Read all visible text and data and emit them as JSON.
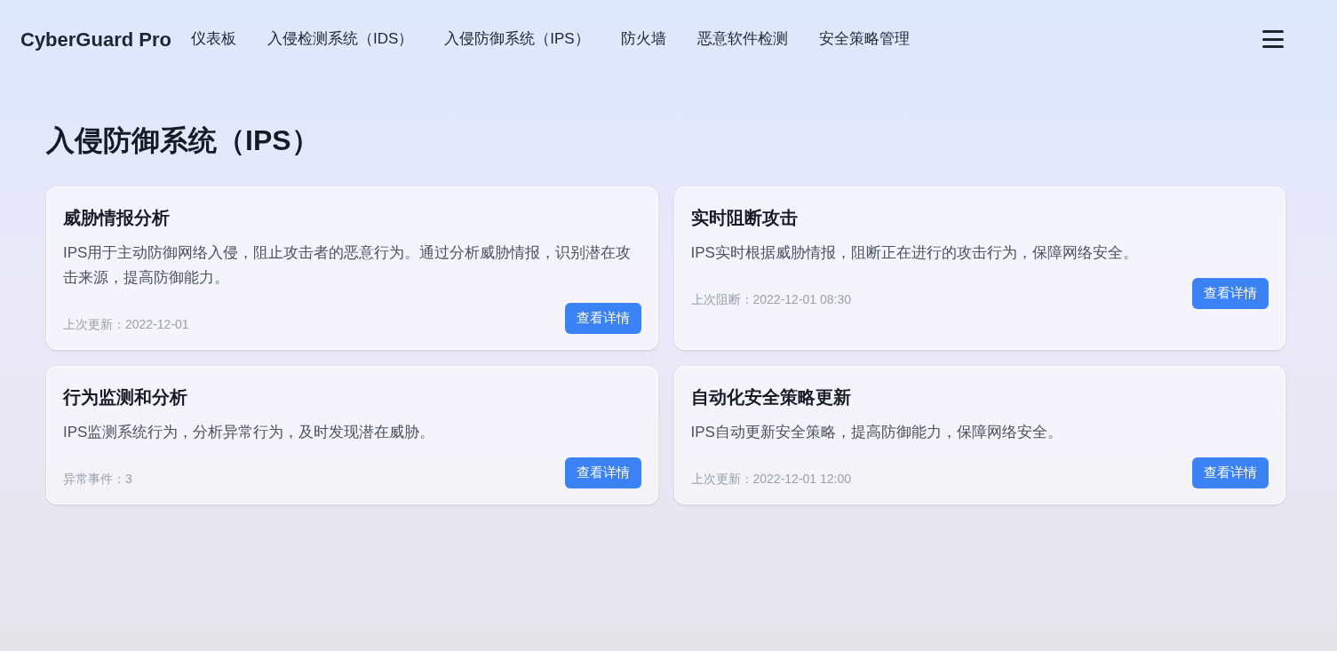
{
  "header": {
    "logo": "CyberGuard Pro",
    "nav": [
      "仪表板",
      "入侵检测系统（IDS）",
      "入侵防御系统（IPS）",
      "防火墙",
      "恶意软件检测",
      "安全策略管理"
    ]
  },
  "page_title": "入侵防御系统（IPS）",
  "cards": [
    {
      "title": "威胁情报分析",
      "description": "IPS用于主动防御网络入侵，阻止攻击者的恶意行为。通过分析威胁情报，识别潜在攻击来源，提高防御能力。",
      "meta": "上次更新：2022-12-01",
      "button": "查看详情"
    },
    {
      "title": "实时阻断攻击",
      "description": "IPS实时根据威胁情报，阻断正在进行的攻击行为，保障网络安全。",
      "meta": "上次阻断：2022-12-01 08:30",
      "button": "查看详情"
    },
    {
      "title": "行为监测和分析",
      "description": "IPS监测系统行为，分析异常行为，及时发现潜在威胁。",
      "meta": "异常事件：3",
      "button": "查看详情"
    },
    {
      "title": "自动化安全策略更新",
      "description": "IPS自动更新安全策略，提高防御能力，保障网络安全。",
      "meta": "上次更新：2022-12-01 12:00",
      "button": "查看详情"
    }
  ]
}
